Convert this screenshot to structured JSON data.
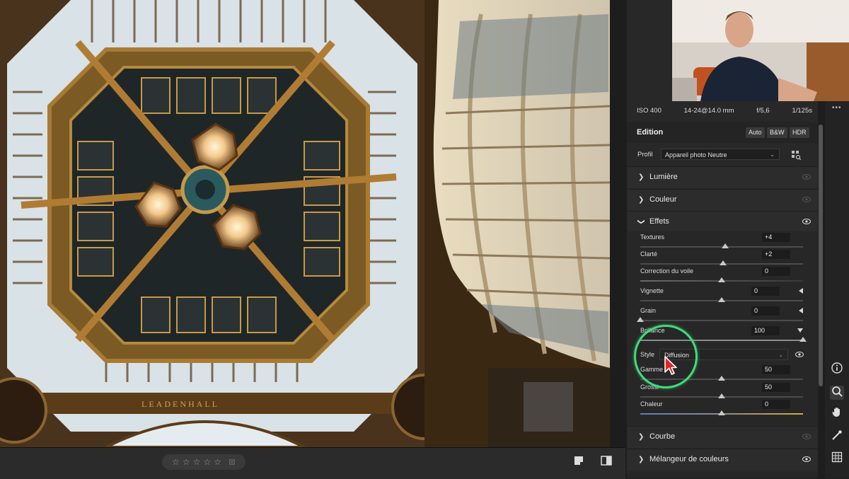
{
  "photo": {
    "alt_subject": "",
    "inscription": "LEADENHALL"
  },
  "filmstrip": {
    "rating_stars": [
      "☆",
      "☆",
      "☆",
      "☆",
      "☆"
    ],
    "flag_icon": "⊠"
  },
  "meta": {
    "iso": "ISO 400",
    "lens": "14-24@14.0 mm",
    "aperture": "f/5,6",
    "shutter": "1/125s"
  },
  "edit": {
    "title": "Edition",
    "modes": [
      "Auto",
      "B&W",
      "HDR"
    ],
    "profile_label": "Profil",
    "profile_value": "Appareil photo Neutre"
  },
  "sections": {
    "lumiere": "Lumière",
    "couleur": "Couleur",
    "effets": "Effets",
    "courbe": "Courbe",
    "melangeur": "Mélangeur de couleurs"
  },
  "effets": {
    "sliders": [
      {
        "label": "Textures",
        "value": "+4",
        "pos": 0.52
      },
      {
        "label": "Clarté",
        "value": "+2",
        "pos": 0.51
      },
      {
        "label": "Correction du voile",
        "value": "0",
        "pos": 0.5
      },
      {
        "label": "Vignette",
        "value": "0",
        "pos": 0.5
      },
      {
        "label": "Grain",
        "value": "0",
        "pos": 0.0
      },
      {
        "label": "Brillance",
        "value": "100",
        "pos": 1.0
      }
    ],
    "style_label": "Style",
    "style_value": "Diffusion",
    "glow_sliders": [
      {
        "label": "Gamme",
        "value": "50",
        "pos": 0.5
      },
      {
        "label": "Grossi",
        "value": "50",
        "pos": 0.5
      },
      {
        "label": "Chaleur",
        "value": "0",
        "pos": 0.5
      }
    ]
  },
  "colors": {
    "highlight": "#3fdc7a",
    "cursor": "#e0262a",
    "panel_bg": "#282828"
  },
  "toolstrip": {
    "icons": [
      "info-icon",
      "zoom-icon",
      "hand-icon",
      "eyedropper-icon",
      "grid-icon"
    ]
  }
}
